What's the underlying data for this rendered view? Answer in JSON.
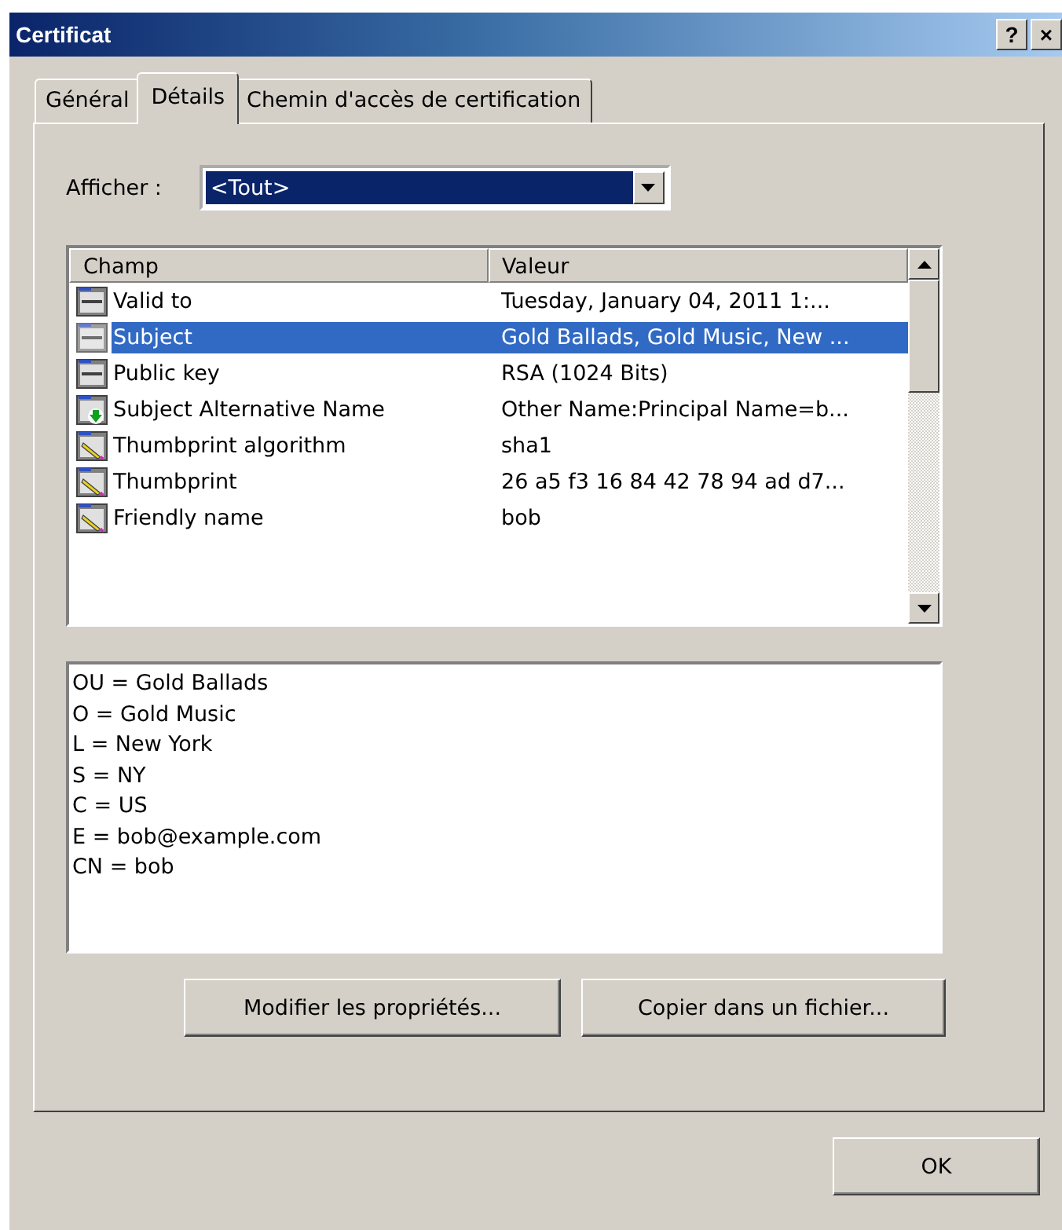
{
  "window": {
    "title": "Certificat",
    "title_buttons": [
      "?",
      "×"
    ]
  },
  "tabs": [
    {
      "label": "Général",
      "selected": false
    },
    {
      "label": "Détails",
      "selected": true
    },
    {
      "label": "Chemin d'accès de certification",
      "selected": false
    }
  ],
  "show": {
    "label": "Afficher :",
    "value": "<Tout>"
  },
  "fields_list": {
    "columns": [
      "Champ",
      "Valeur"
    ],
    "rows": [
      {
        "kind": "field",
        "field": "Valid to",
        "value": "Tuesday, January 04, 2011 1:...",
        "selected": false
      },
      {
        "kind": "field",
        "field": "Subject",
        "value": "Gold Ballads, Gold Music, New ...",
        "selected": true
      },
      {
        "kind": "field",
        "field": "Public key",
        "value": "RSA (1024 Bits)",
        "selected": false
      },
      {
        "kind": "extension",
        "field": "Subject Alternative Name",
        "value": "Other Name:Principal Name=b...",
        "selected": false
      },
      {
        "kind": "property",
        "field": "Thumbprint algorithm",
        "value": "sha1",
        "selected": false
      },
      {
        "kind": "property",
        "field": "Thumbprint",
        "value": "26 a5 f3 16 84 42 78 94 ad d7...",
        "selected": false
      },
      {
        "kind": "property",
        "field": "Friendly name",
        "value": "bob",
        "selected": false
      }
    ]
  },
  "detail_lines": [
    "OU = Gold Ballads",
    "O = Gold Music",
    "L = New York",
    "S = NY",
    "C = US",
    "E = bob@example.com",
    "CN = bob"
  ],
  "buttons": [
    "Modifier les propriétés...",
    "Copier dans un fichier..."
  ],
  "ok_button": "OK"
}
